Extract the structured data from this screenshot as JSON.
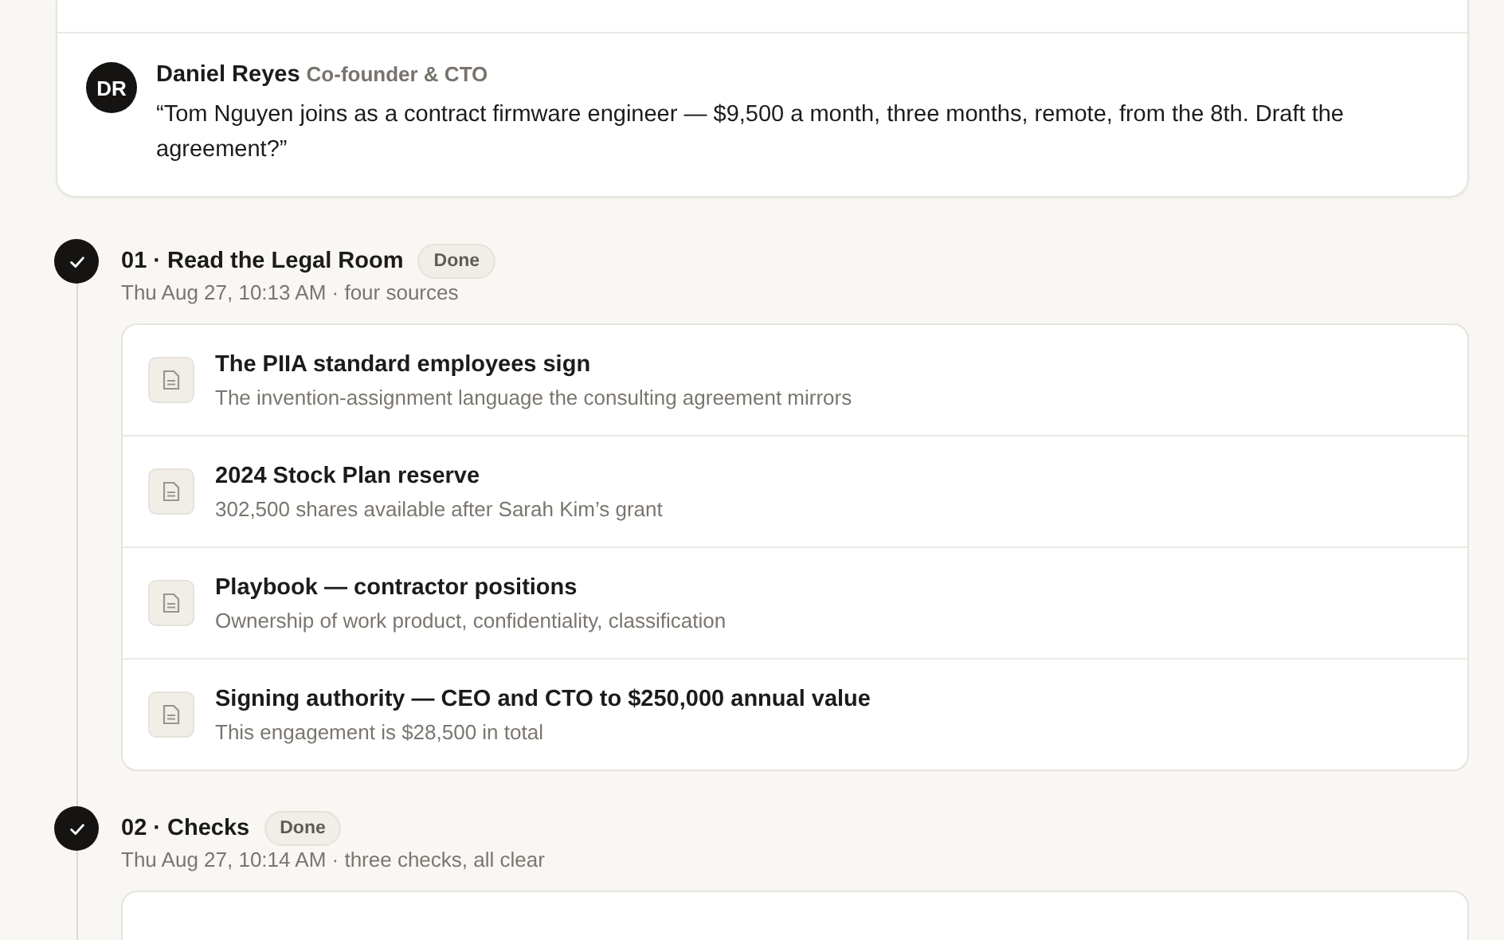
{
  "message": {
    "initials": "DR",
    "author": "Daniel Reyes",
    "role": "Co-founder & CTO",
    "quote": "“Tom Nguyen joins as a contract firmware engineer — $9,500 a month, three months, remote, from the 8th. Draft the agreement?”"
  },
  "steps": [
    {
      "title": "01 · Read the Legal Room",
      "badge": "Done",
      "done": true,
      "meta": "Thu Aug 27, 10:13 AM · four sources",
      "sources": [
        {
          "title": "The PIIA standard employees sign",
          "detail": "The invention-assignment language the consulting agreement mirrors"
        },
        {
          "title": "2024 Stock Plan reserve",
          "detail": "302,500 shares available after Sarah Kim’s grant"
        },
        {
          "title": "Playbook — contractor positions",
          "detail": "Ownership of work product, confidentiality, classification"
        },
        {
          "title": "Signing authority — CEO and CTO to $250,000 annual value",
          "detail": "This engagement is $28,500 in total"
        }
      ]
    },
    {
      "title": "02 · Checks",
      "badge": "Done",
      "done": true,
      "meta": "Thu Aug 27, 10:14 AM · three checks, all clear"
    }
  ]
}
